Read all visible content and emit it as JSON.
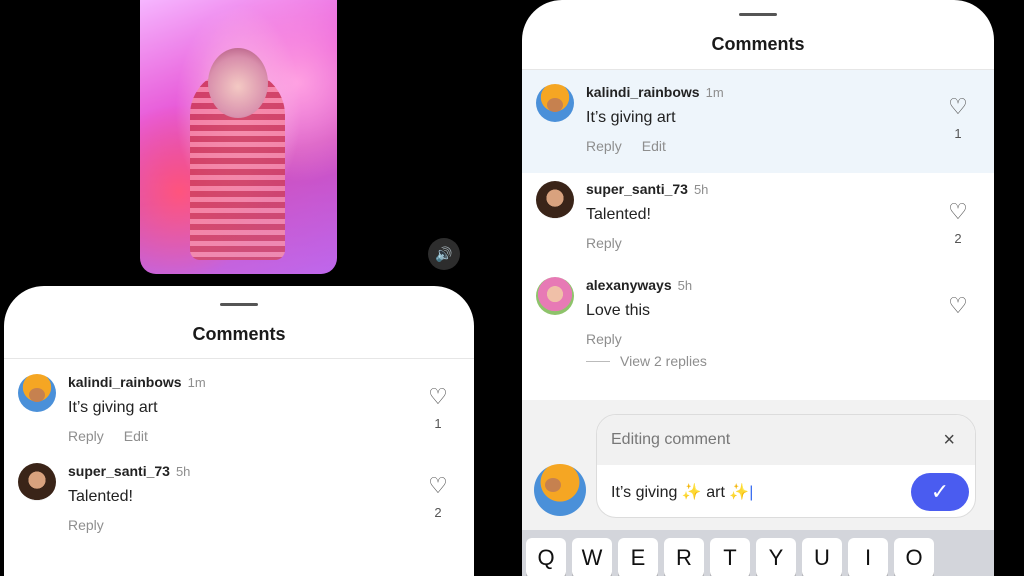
{
  "sheet_title": "Comments",
  "comments": [
    {
      "user": "kalindi_rainbows",
      "time": "1m",
      "text": "It’s giving art",
      "reply": "Reply",
      "edit": "Edit",
      "likes": "1"
    },
    {
      "user": "super_santi_73",
      "time": "5h",
      "text": "Talented!",
      "reply": "Reply",
      "likes": "2"
    },
    {
      "user": "alexanyways",
      "time": "5h",
      "text": "Love this",
      "reply": "Reply",
      "likes": ""
    }
  ],
  "view_replies": "View 2 replies",
  "editing": {
    "banner": "Editing comment",
    "close": "×",
    "value": "It’s giving ✨ art ✨",
    "cursor": "|",
    "send": "✓"
  },
  "keyboard": [
    "Q",
    "W",
    "E",
    "R",
    "T",
    "Y",
    "U",
    "I",
    "O"
  ],
  "icons": {
    "heart": "♡",
    "speaker": "🔊"
  }
}
